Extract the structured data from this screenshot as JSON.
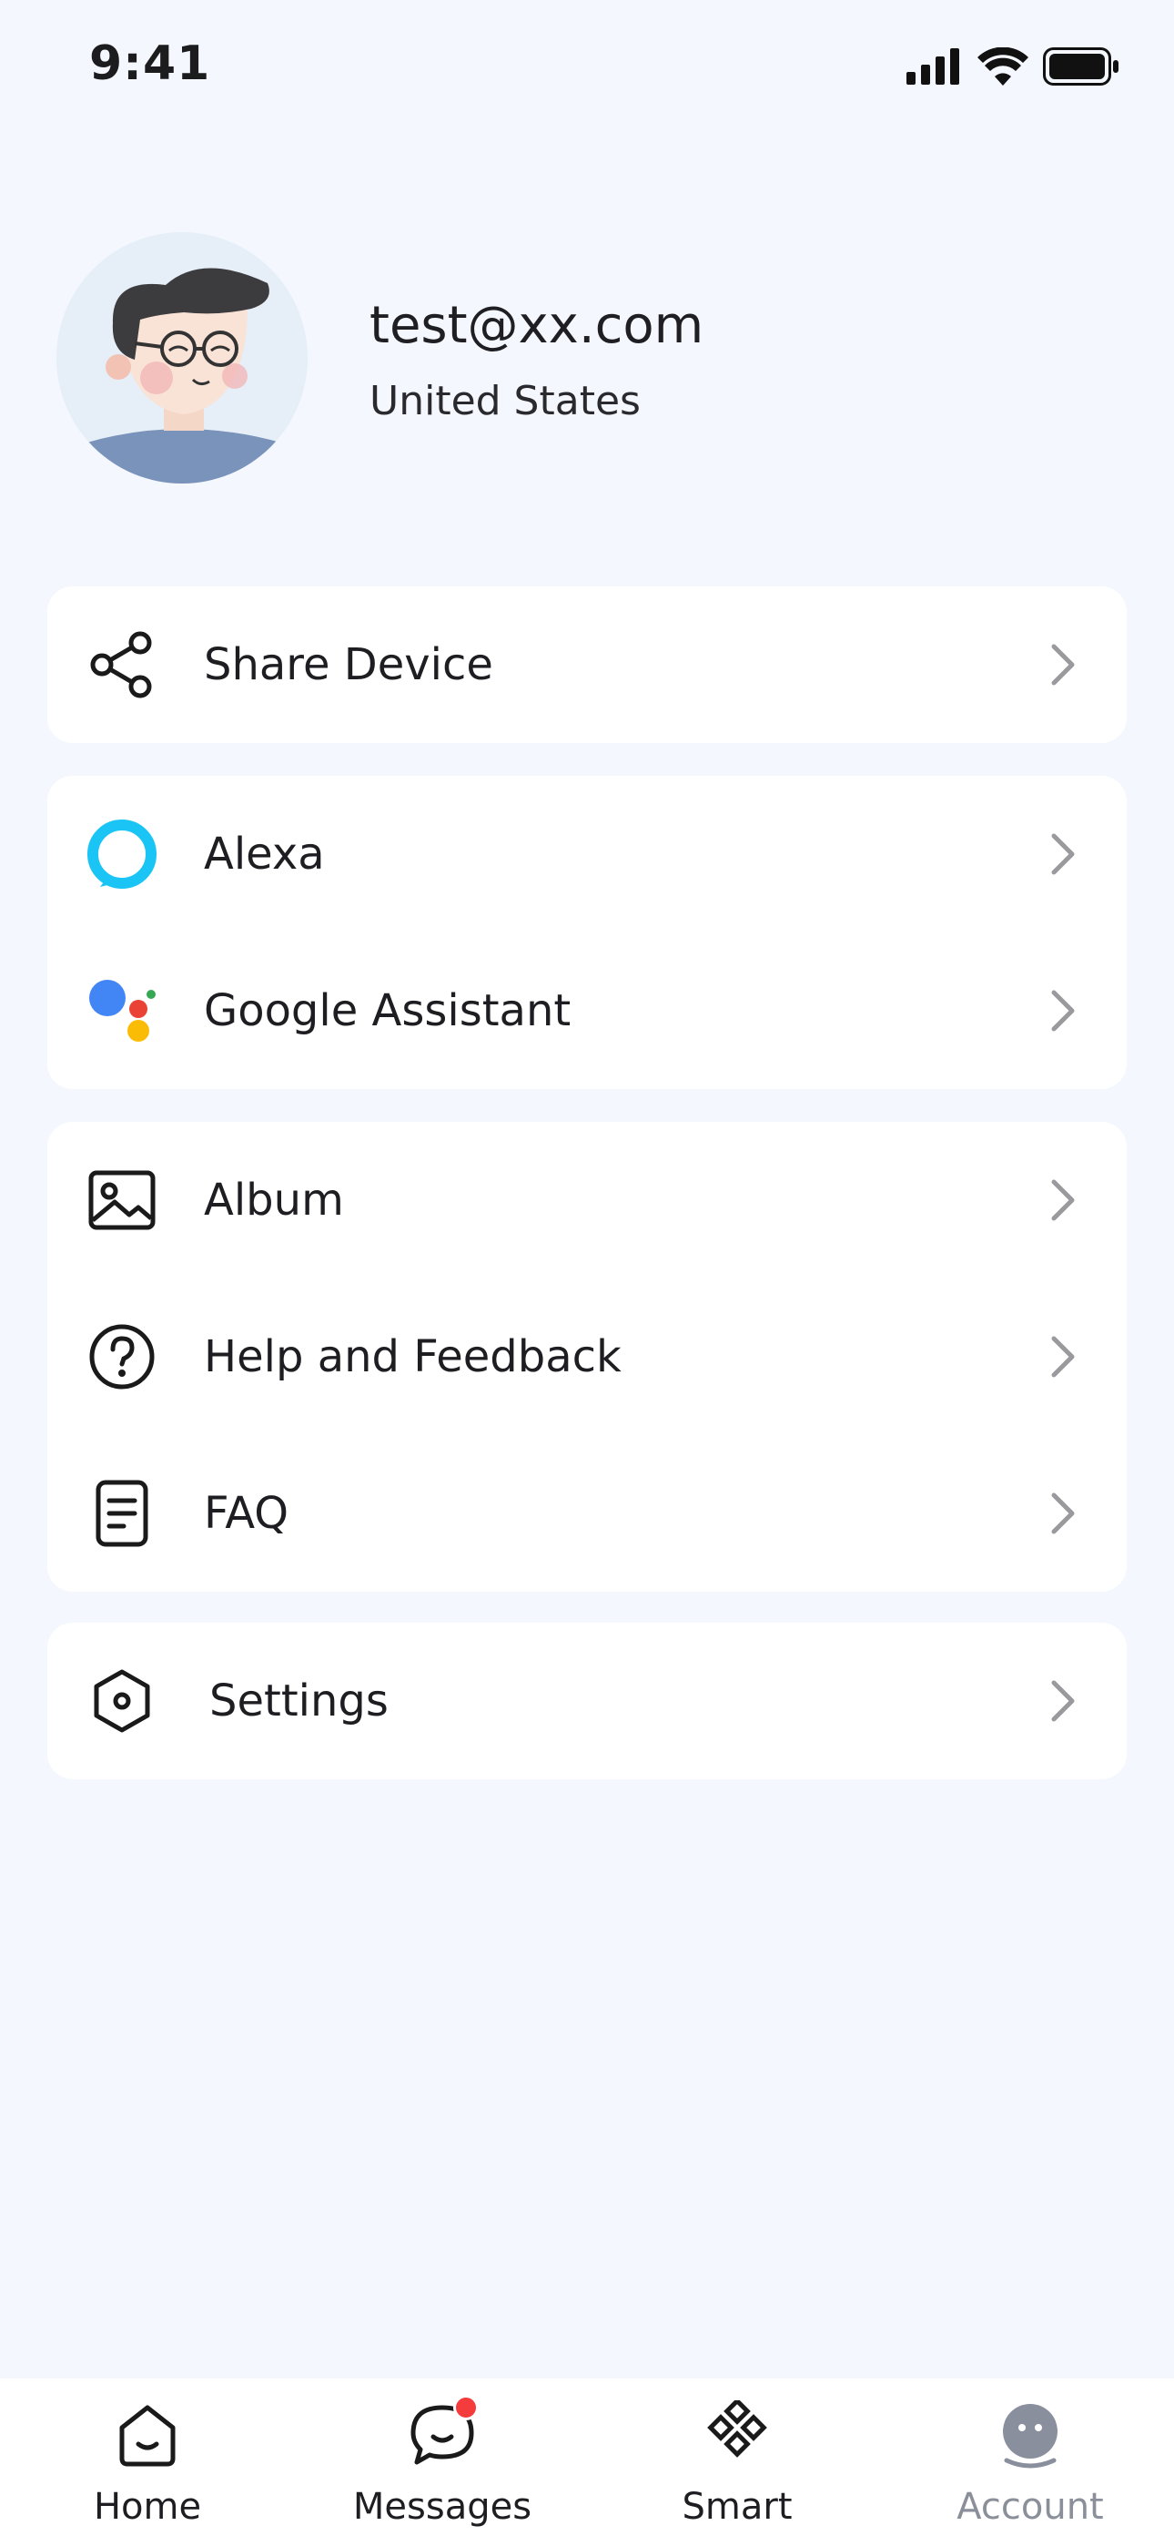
{
  "status_bar": {
    "time": "9:41"
  },
  "profile": {
    "email": "test@xx.com",
    "country": "United States",
    "avatar_icon": "user-avatar-illustration"
  },
  "menu": {
    "share_section": [
      {
        "label": "Share Device",
        "icon": "share-icon"
      }
    ],
    "assistants_section": [
      {
        "label": "Alexa",
        "icon": "alexa-icon",
        "color": "#1AC5F5"
      },
      {
        "label": "Google Assistant",
        "icon": "google-assistant-icon"
      }
    ],
    "support_section": [
      {
        "label": "Album",
        "icon": "album-icon"
      },
      {
        "label": "Help and Feedback",
        "icon": "help-icon"
      },
      {
        "label": "FAQ",
        "icon": "faq-icon"
      }
    ],
    "settings_section": [
      {
        "label": "Settings",
        "icon": "settings-icon"
      }
    ]
  },
  "tabbar": {
    "tabs": [
      {
        "label": "Home",
        "icon": "home-icon",
        "active": false
      },
      {
        "label": "Messages",
        "icon": "messages-icon",
        "active": false,
        "badge": true
      },
      {
        "label": "Smart",
        "icon": "smart-icon",
        "active": false
      },
      {
        "label": "Account",
        "icon": "account-icon",
        "active": true
      }
    ]
  },
  "colors": {
    "background": "#F4F8FE",
    "card": "#FFFFFF",
    "badge": "#F43C3C",
    "muted_tab": "#8A8F99"
  }
}
